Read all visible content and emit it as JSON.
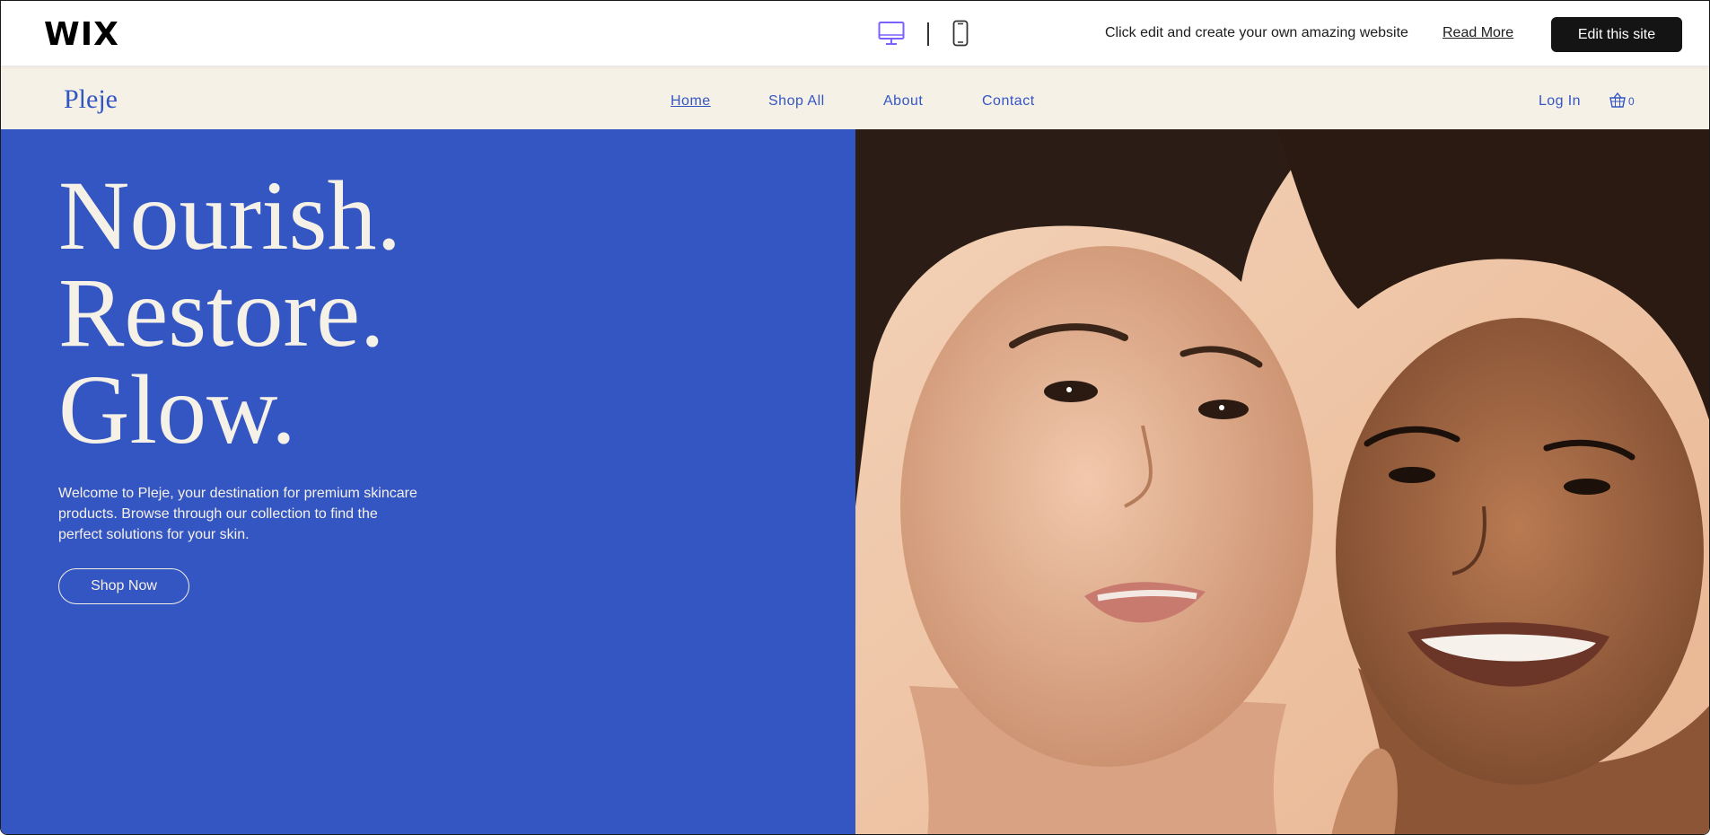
{
  "wix_bar": {
    "logo": "WIX",
    "promo_text": "Click edit and create your own amazing website",
    "read_more_label": "Read More",
    "edit_button_label": "Edit this site",
    "desktop_icon": "desktop-icon",
    "mobile_icon": "mobile-icon",
    "accent_color": "#7b61ff"
  },
  "header": {
    "brand": "Pleje",
    "nav": [
      {
        "label": "Home",
        "active": true
      },
      {
        "label": "Shop All",
        "active": false
      },
      {
        "label": "About",
        "active": false
      },
      {
        "label": "Contact",
        "active": false
      }
    ],
    "login_label": "Log In",
    "cart_icon": "basket-icon",
    "cart_count": "0",
    "background_color": "#f6f1e7",
    "brand_color": "#3456c3"
  },
  "hero": {
    "headline": [
      "Nourish.",
      "Restore.",
      "Glow."
    ],
    "intro": "Welcome to Pleje, your destination for premium skincare products. Browse through our collection to find the perfect solutions for your skin.",
    "cta_label": "Shop Now",
    "panel_color": "#3456c3",
    "image": "two-smiling-women-portrait"
  }
}
